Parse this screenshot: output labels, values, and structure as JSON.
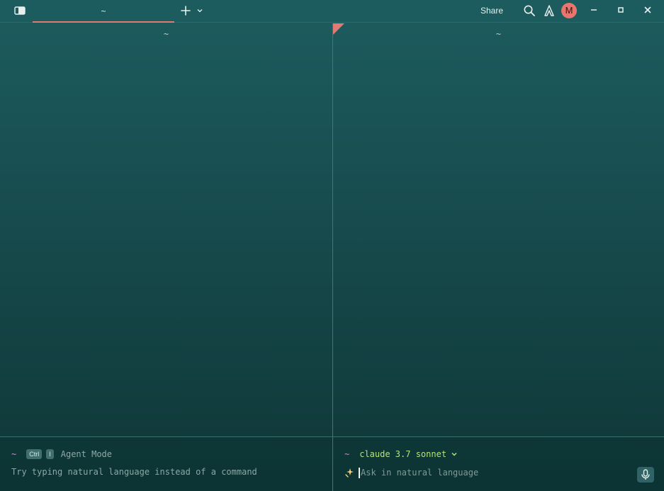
{
  "titlebar": {
    "tab_label": "~",
    "share_label": "Share",
    "avatar_initial": "M",
    "icons": [
      "panel-icon",
      "plus-icon",
      "chevron-down-icon",
      "search-icon",
      "warp-icon",
      "minimize-icon",
      "maximize-icon",
      "close-icon"
    ]
  },
  "left_pane": {
    "header": "~",
    "prompt_symbol": "~",
    "shortcut_keys": [
      "Ctrl",
      "I"
    ],
    "mode_label": "Agent Mode",
    "hint": "Try typing natural language instead of a command"
  },
  "right_pane": {
    "header": "~",
    "prompt_symbol": "~",
    "model_label": "claude 3.7 sonnet",
    "input_placeholder": "Ask in natural language"
  },
  "colors": {
    "accent": "#e07a73",
    "model_green": "#b7e27d",
    "tilde_pink": "#d08bcf"
  }
}
